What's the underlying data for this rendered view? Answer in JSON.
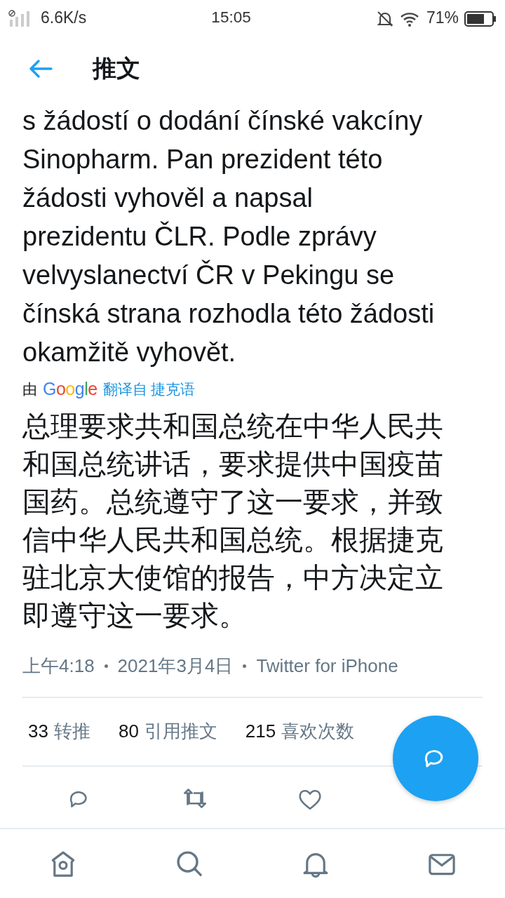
{
  "status_bar": {
    "speed": "6.6K/s",
    "time": "15:05",
    "battery": "71%"
  },
  "header": {
    "title": "推文"
  },
  "tweet": {
    "original_text": [
      "s žádostí o dodání čínské vakcíny",
      "Sinopharm. Pan prezident této žádosti vyhověl a napsal prezidentu ČLR. Podle zprávy velvyslanectví ČR v Pekingu se čínská strana rozhodla této žádosti okamžitě vyhovět."
    ],
    "translation_note": {
      "prefix": "由",
      "brand": "Google",
      "link": "翻译自 捷克语"
    },
    "translated_text": "总理要求共和国总统在中华人民共和国总统讲话，要求提供中国疫苗国药。总统遵守了这一要求，并致信中华人民共和国总统。根据捷克驻北京大使馆的报告，中方决定立即遵守这一要求。",
    "meta": [
      "上午4:18",
      "2021年3月4日",
      "Twitter for iPhone"
    ],
    "stats": [
      {
        "count": "33",
        "label": "转推"
      },
      {
        "count": "80",
        "label": "引用推文"
      },
      {
        "count": "215",
        "label": "喜欢次数"
      }
    ]
  },
  "actions": [
    {
      "kind": "reply"
    },
    {
      "kind": "retweet"
    },
    {
      "kind": "like"
    }
  ],
  "bottom_nav": [
    {
      "kind": "home"
    },
    {
      "kind": "search"
    },
    {
      "kind": "notifications"
    },
    {
      "kind": "messages"
    }
  ]
}
